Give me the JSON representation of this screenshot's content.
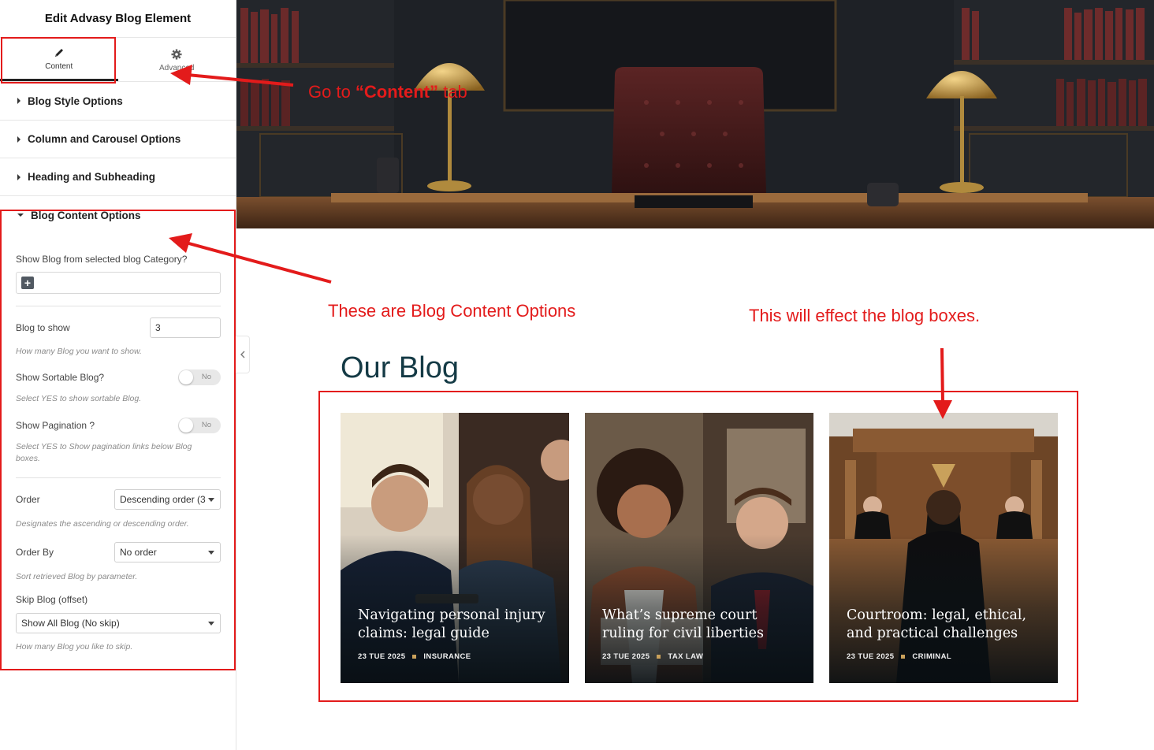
{
  "sidebar": {
    "title": "Edit Advasy Blog Element",
    "tabs": [
      {
        "label": "Content",
        "icon": "pencil-icon"
      },
      {
        "label": "Advanced",
        "icon": "gear-icon"
      }
    ],
    "sections": [
      {
        "label": "Blog Style Options"
      },
      {
        "label": "Column and Carousel Options"
      },
      {
        "label": "Heading and Subheading"
      },
      {
        "label": "Blog Content Options"
      }
    ],
    "content_options": {
      "category_label": "Show Blog from selected blog Category?",
      "blog_to_show_label": "Blog to show",
      "blog_to_show_value": "3",
      "blog_to_show_help": "How many Blog you want to show.",
      "sortable_label": "Show Sortable Blog?",
      "sortable_value": "No",
      "sortable_help": "Select YES to show sortable Blog.",
      "pagination_label": "Show Pagination ?",
      "pagination_value": "No",
      "pagination_help": "Select YES to Show pagination links below Blog boxes.",
      "order_label": "Order",
      "order_value": "Descending order (3",
      "order_help": "Designates the ascending or descending order.",
      "order_by_label": "Order By",
      "order_by_value": "No order",
      "order_by_help": "Sort retrieved Blog by parameter.",
      "skip_label": "Skip Blog (offset)",
      "skip_value": "Show All Blog (No skip)",
      "skip_help": "How many Blog you like to skip."
    }
  },
  "main": {
    "heading": "Our Blog",
    "posts": [
      {
        "title": "Navigating personal injury claims: legal guide",
        "date": "23 TUE 2025",
        "category": "INSURANCE"
      },
      {
        "title": "What’s supreme court ruling for civil liberties",
        "date": "23 TUE 2025",
        "category": "TAX LAW"
      },
      {
        "title": "Courtroom: legal, ethical, and practical challenges",
        "date": "23 TUE 2025",
        "category": "CRIMINAL"
      }
    ]
  },
  "annotations": {
    "content_tab_pre": "Go  to ",
    "content_tab_bold": "“Content”",
    "content_tab_post": " tab",
    "content_options_note": "These are Blog Content Options",
    "effect_note": "This will effect the blog boxes."
  },
  "colors": {
    "annotation_red": "#e31b1b",
    "heading_teal": "#143a45",
    "meta_gold": "#c9a15b"
  }
}
